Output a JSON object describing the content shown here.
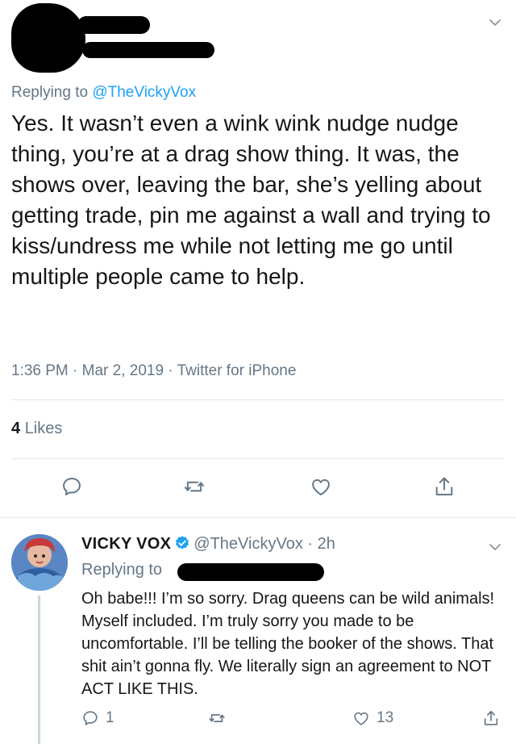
{
  "top_tweet": {
    "replying_prefix": "Replying to",
    "replying_handle": "@TheVickyVox",
    "text": "Yes. It wasn’t even a wink wink nudge nudge thing, you’re at a drag show thing. It was, the shows over, leaving the bar, she’s yelling about getting trade, pin me against a wall and trying to kiss/undress me while not letting me go until multiple people came to help.",
    "meta": "1:36 PM · Mar 2, 2019 · Twitter for iPhone",
    "likes_count": "4",
    "likes_label": "Likes",
    "actions": [
      "reply-icon",
      "retweet-icon",
      "like-icon",
      "share-icon"
    ]
  },
  "reply_tweet": {
    "name": "VICKY VOX",
    "handle_time": "@TheVickyVox · 2h",
    "replying_prefix": "Replying to",
    "text": "Oh babe!!! I’m so sorry. Drag queens can be wild animals! Myself included. I’m truly sorry you made to be uncomfortable. I’ll be telling the booker of the shows. That shit ain’t gonna fly. We literally sign an agreement to NOT ACT LIKE THIS.",
    "reply_count": "1",
    "like_count": "13"
  },
  "colors": {
    "accent": "#1da1f2",
    "secondary_text": "#657786",
    "primary_text": "#14171a",
    "divider": "#e1e8ed"
  }
}
